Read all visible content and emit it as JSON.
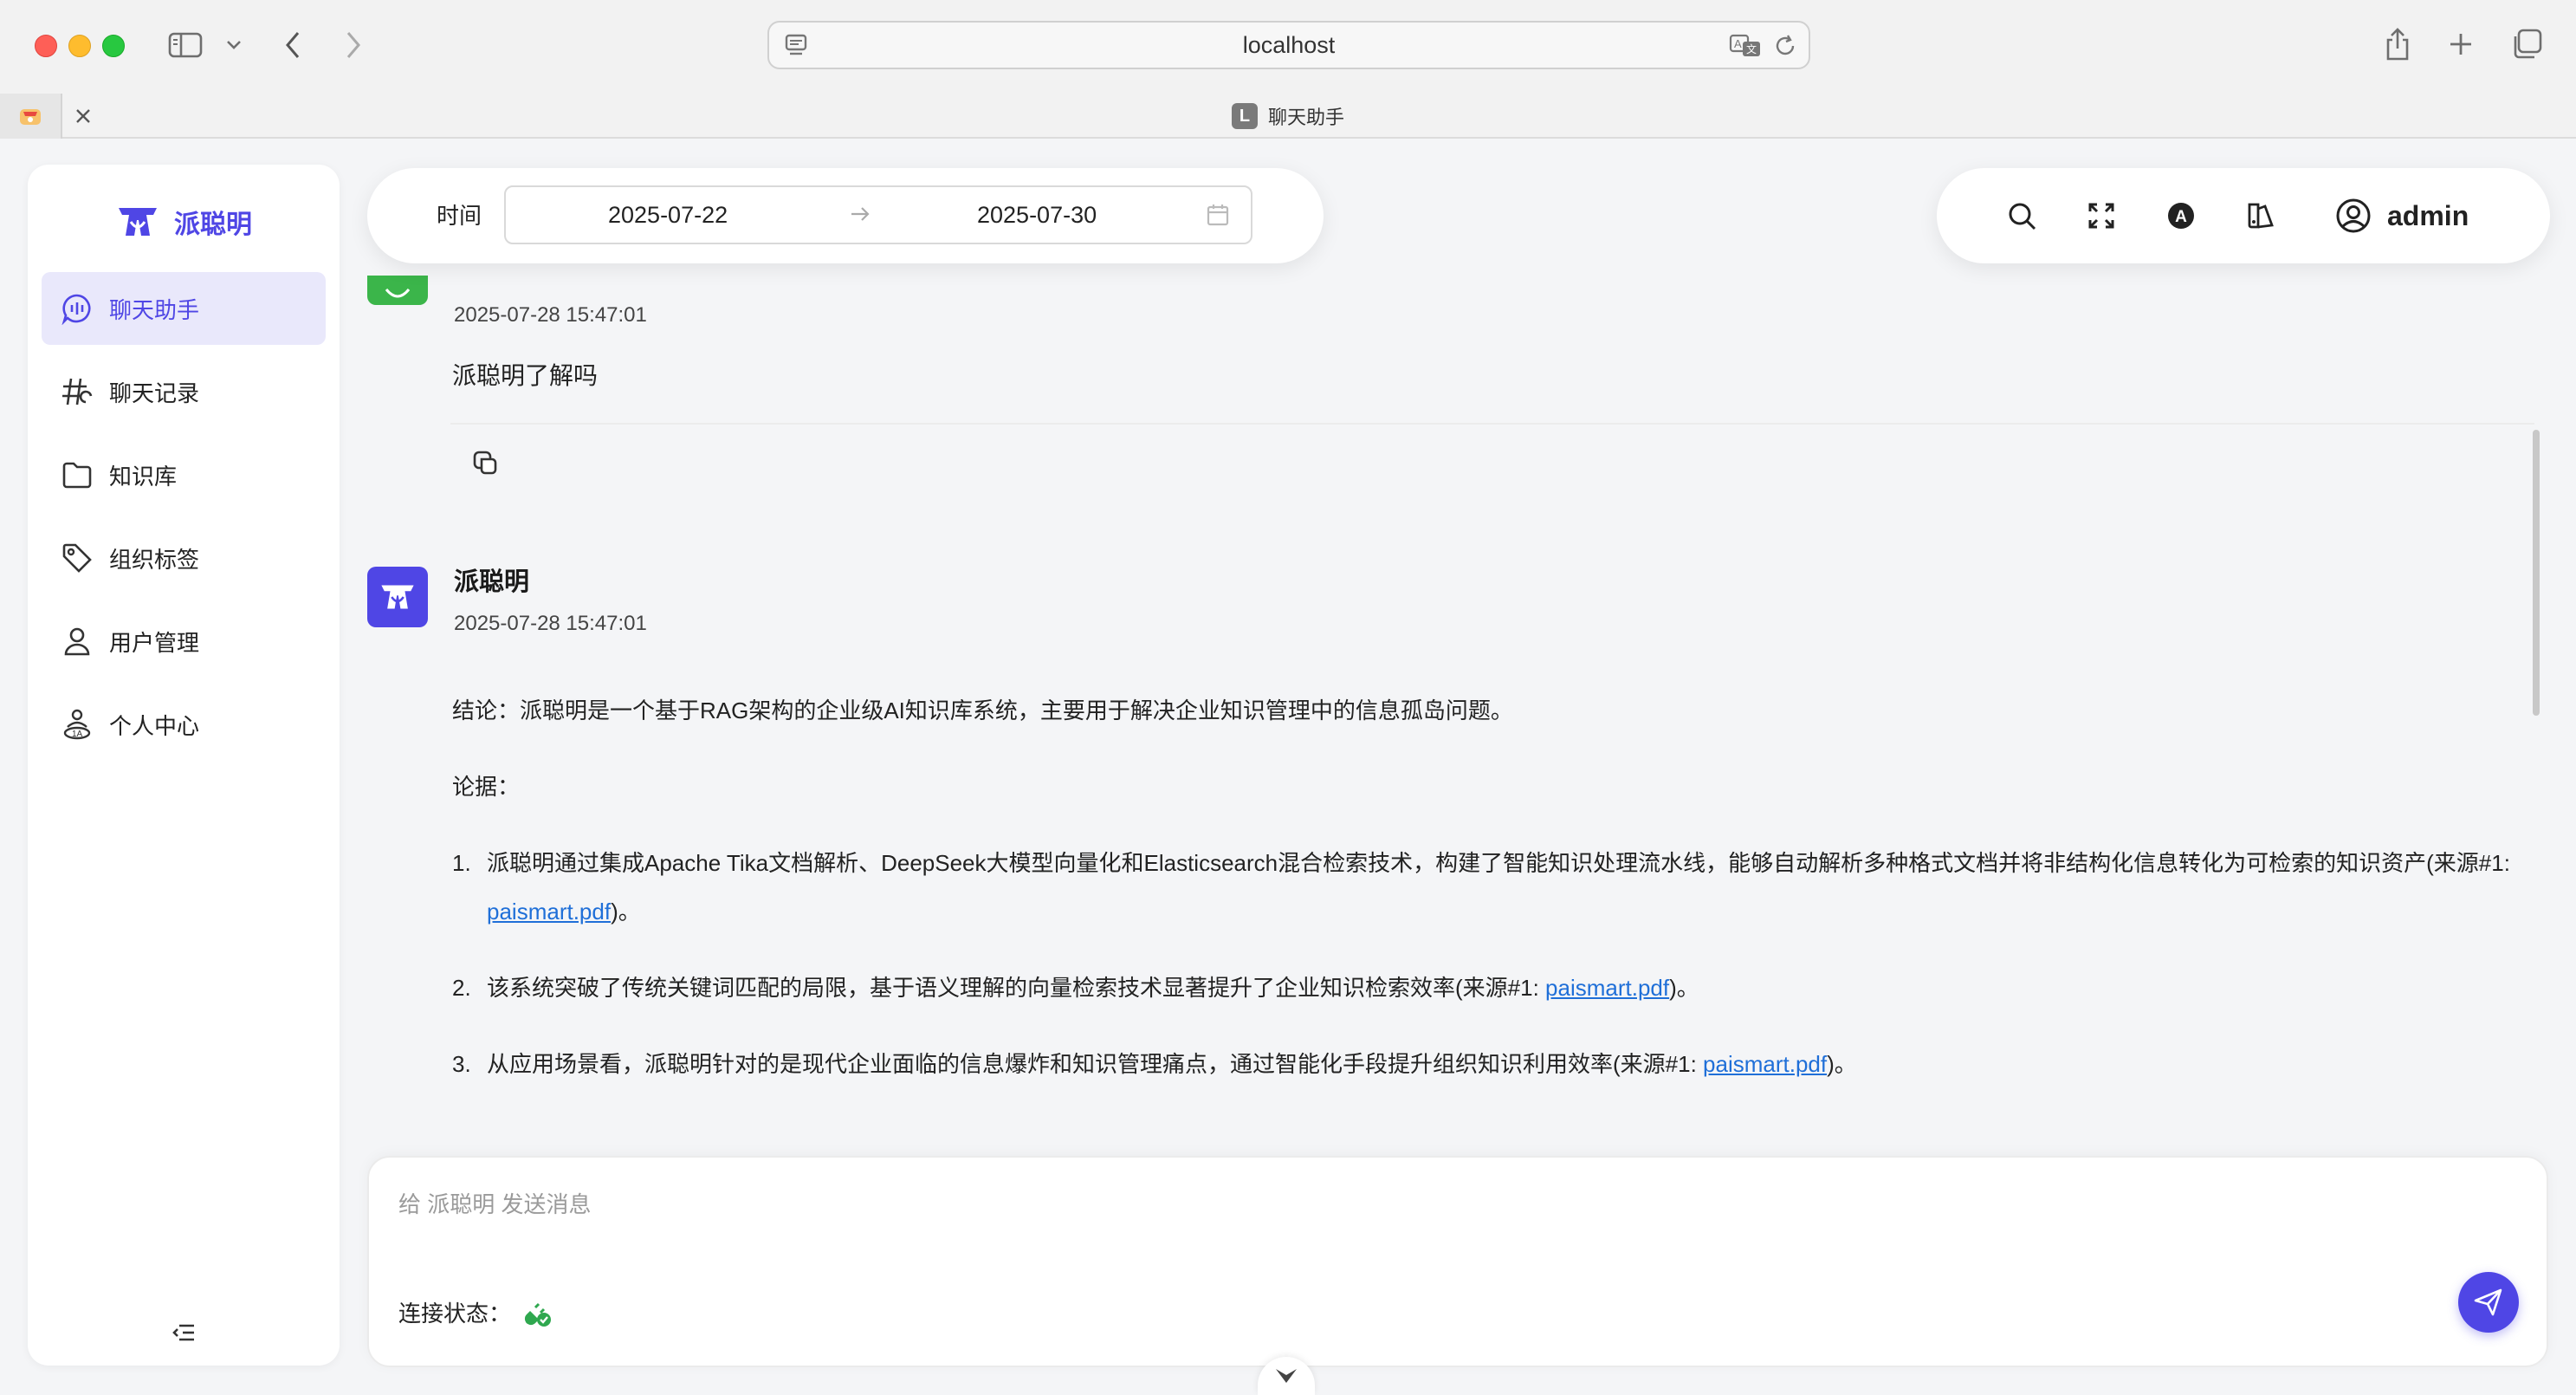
{
  "browser": {
    "address": "localhost",
    "tab_badge": "L",
    "tab_title": "聊天助手"
  },
  "sidebar": {
    "brand": "派聪明",
    "items": [
      {
        "label": "聊天助手",
        "icon": "chat-bubble-icon",
        "active": true
      },
      {
        "label": "聊天记录",
        "icon": "hash-icon",
        "active": false
      },
      {
        "label": "知识库",
        "icon": "folder-icon",
        "active": false
      },
      {
        "label": "组织标签",
        "icon": "tag-icon",
        "active": false
      },
      {
        "label": "用户管理",
        "icon": "user-icon",
        "active": false
      },
      {
        "label": "个人中心",
        "icon": "person-center-icon",
        "active": false
      }
    ]
  },
  "header": {
    "time_label": "时间",
    "start_date": "2025-07-22",
    "end_date": "2025-07-30",
    "username": "admin"
  },
  "chat": {
    "user_message": {
      "time": "2025-07-28 15:47:01",
      "text": "派聪明了解吗"
    },
    "bot_message": {
      "name": "派聪明",
      "time": "2025-07-28 15:47:01",
      "conclusion": "结论：派聪明是一个基于RAG架构的企业级AI知识库系统，主要用于解决企业知识管理中的信息孤岛问题。",
      "evidence_label": "论据：",
      "points": [
        {
          "num": "1.",
          "text": "派聪明通过集成Apache Tika文档解析、DeepSeek大模型向量化和Elasticsearch混合检索技术，构建了智能知识处理流水线，能够自动解析多种格式文档并将非结构化信息转化为可检索的知识资产(来源#1: ",
          "link": "paismart.pdf",
          "tail": ")。"
        },
        {
          "num": "2.",
          "text": "该系统突破了传统关键词匹配的局限，基于语义理解的向量检索技术显著提升了企业知识检索效率(来源#1: ",
          "link": "paismart.pdf",
          "tail": ")。"
        },
        {
          "num": "3.",
          "text": "从应用场景看，派聪明针对的是现代企业面临的信息爆炸和知识管理痛点，通过智能化手段提升组织知识利用效率(来源#1: ",
          "link": "paismart.pdf",
          "tail": ")。"
        }
      ]
    }
  },
  "input": {
    "placeholder": "给 派聪明 发送消息",
    "status_label": "连接状态："
  },
  "colors": {
    "accent": "#4f46e5",
    "user_avatar": "#3bb54a",
    "link": "#1f6fd8"
  }
}
